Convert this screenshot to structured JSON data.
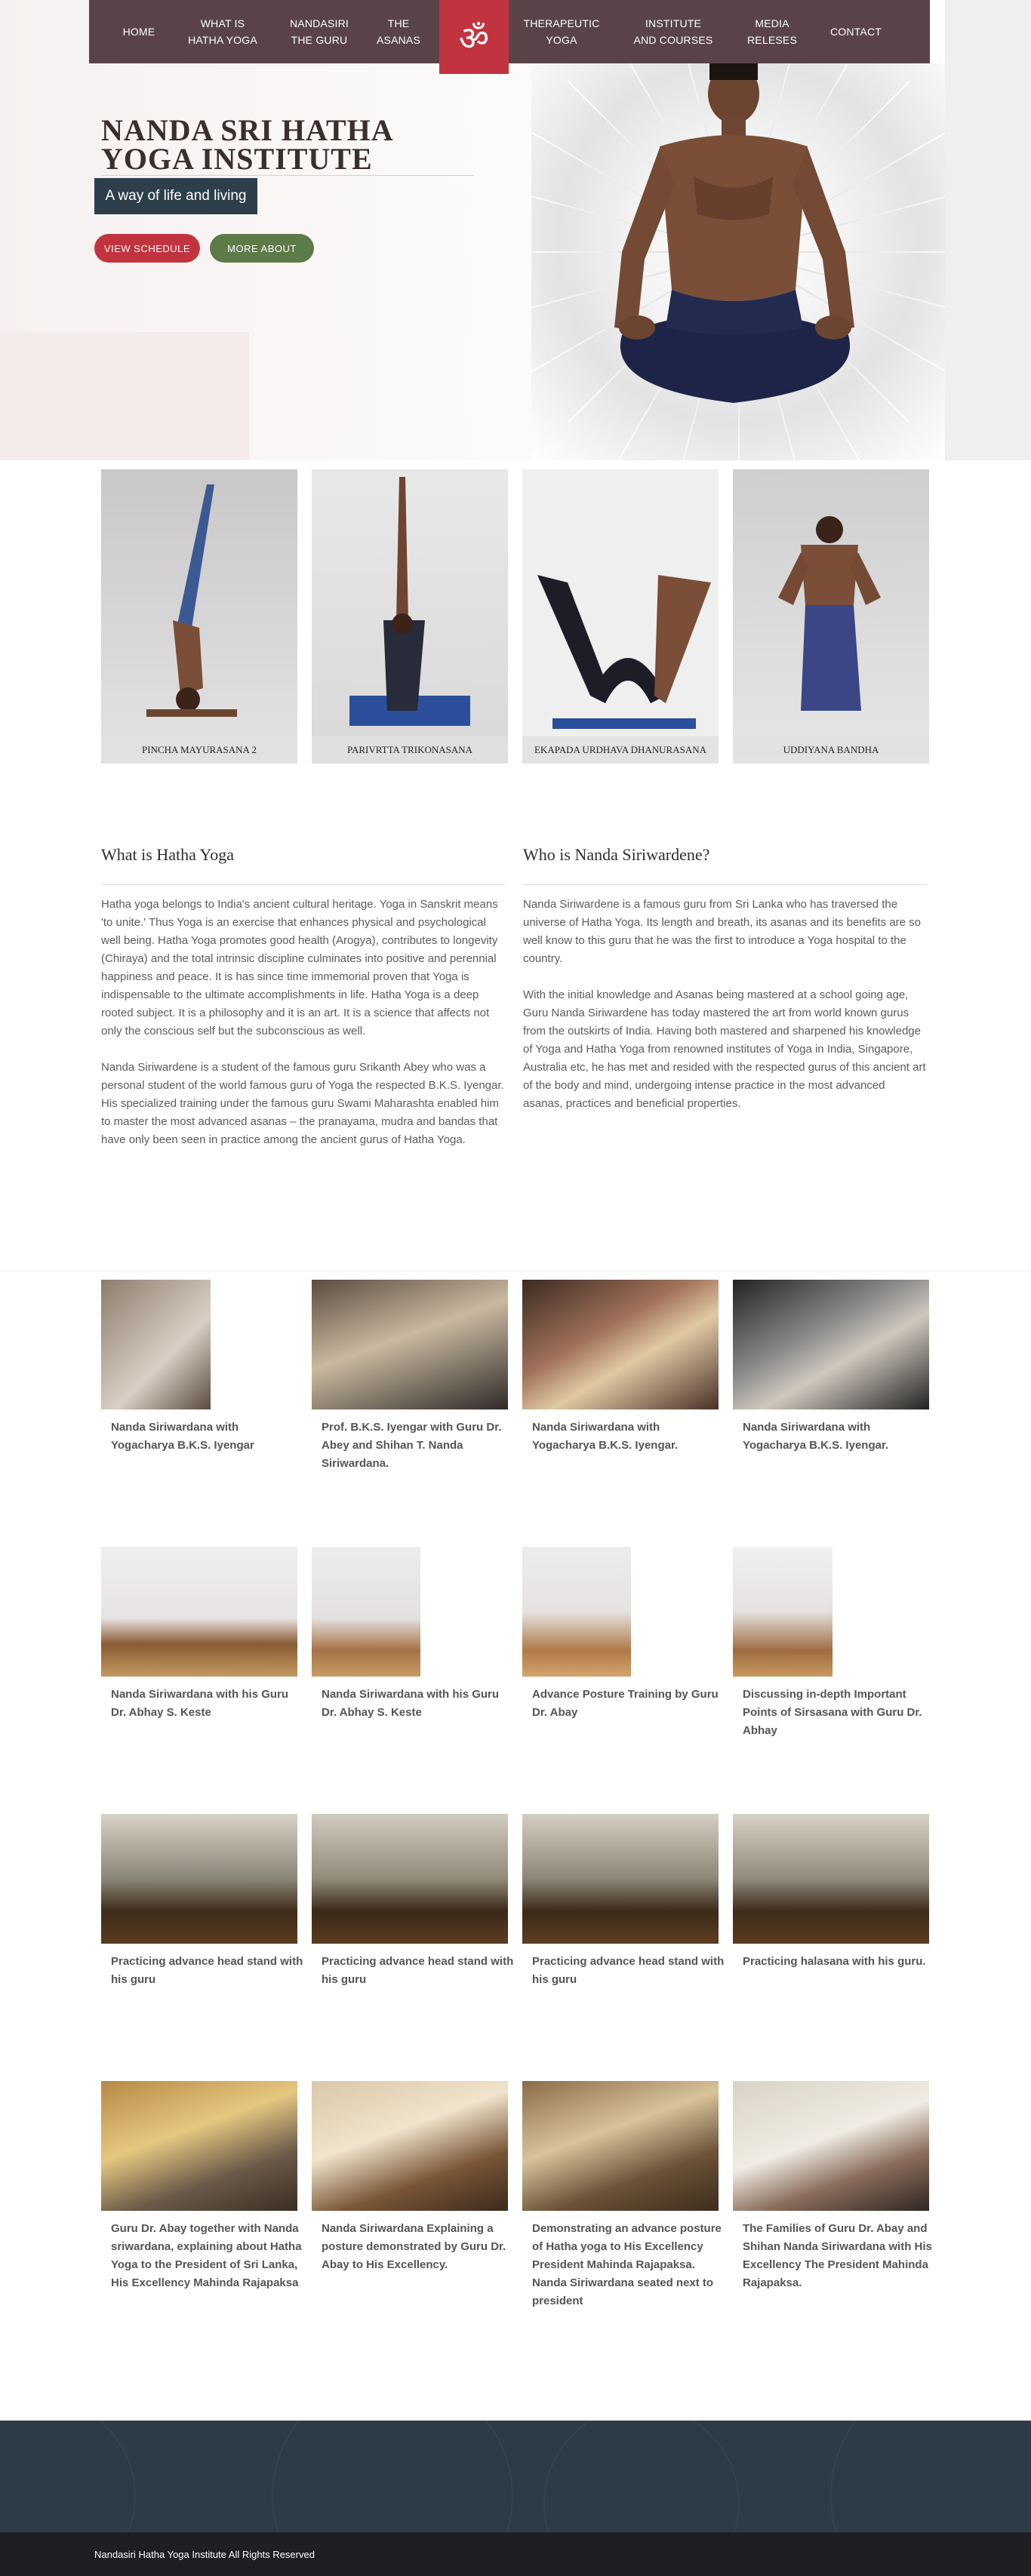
{
  "nav": {
    "items": [
      "HOME",
      "WHAT IS\nHATHA YOGA",
      "NANDASIRI\nTHE GURU",
      "THE\nASANAS",
      "THERAPEUTIC\nYOGA",
      "INSTITUTE\nAND COURSES",
      "MEDIA\nRELESES",
      "CONTACT"
    ],
    "logo": "ॐ"
  },
  "hero": {
    "title": "NANDA SRI HATHA YOGA INSTITUTE",
    "tagline": "A way of life and living",
    "primary_button": "VIEW SCHEDULE",
    "secondary_button": "MORE ABOUT"
  },
  "asanas": [
    "PINCHA MAYURASANA 2",
    "PARIVRTTA TRIKONASANA",
    "EKAPADA URDHAVA DHANURASANA",
    "UDDIYANA BANDHA"
  ],
  "about": {
    "left_title": "What is Hatha Yoga",
    "left_p1": "Hatha yoga belongs to India's ancient cultural heritage. Yoga in Sanskrit means 'to unite.' Thus Yoga is an exercise that enhances physical and psychological well being. Hatha Yoga promotes good health (Arogya), contributes to longevity (Chiraya) and the total intrinsic discipline culminates into positive and perennial happiness and peace. It is has since time immemorial proven that Yoga is indispensable to the ultimate accomplishments in life. Hatha Yoga is a deep rooted subject. It is a philosophy and it is an art. It is a science that affects not only the conscious self but the subconscious as well.",
    "left_p2": "Nanda Siriwardene is a student of the famous guru Srikanth Abey who was a personal student of the world famous guru of Yoga the respected B.K.S. Iyengar. His specialized training under the famous guru Swami Maharashta enabled him to master the most advanced asanas – the pranayama, mudra and bandas that have only been seen in practice among the ancient gurus of Hatha Yoga.",
    "right_title": "Who is Nanda Siriwardene?",
    "right_p1": "Nanda Siriwardene is a famous guru from Sri Lanka who has traversed the universe of Hatha Yoga. Its length and breath, its asanas and its benefits are so well know to this guru that he was the first to introduce a Yoga hospital to the country.",
    "right_p2": "With the initial knowledge and Asanas being mastered at a school going age, Guru Nanda Siriwardene has today mastered the art from world known gurus from the outskirts of India. Having both mastered and sharpened his knowledge of Yoga and Hatha Yoga from renowned institutes of Yoga in India, Singapore, Australia etc, he has met and resided with the respected gurus of this ancient art of the body and mind, undergoing intense practice in the most advanced asanas, practices and beneficial properties."
  },
  "gallery": [
    [
      "Nanda Siriwardana with Yogacharya B.K.S. Iyengar",
      "Prof. B.K.S. Iyengar with Guru Dr. Abey and Shihan T. Nanda Siriwardana.",
      "Nanda Siriwardana with Yogacharya B.K.S. Iyengar.",
      "Nanda Siriwardana with Yogacharya B.K.S. Iyengar."
    ],
    [
      "Nanda Siriwardana with his Guru Dr. Abhay S. Keste",
      "Nanda Siriwardana with his Guru Dr. Abhay S. Keste",
      "Advance Posture Training by Guru Dr. Abay",
      "Discussing in-depth Important Points of Sirsasana with Guru Dr. Abhay"
    ],
    [
      "Practicing advance head stand with his guru",
      "Practicing advance head stand with his guru",
      "Practicing advance head stand with his guru",
      "Practicing halasana with his guru."
    ],
    [
      "Guru Dr. Abay together with Nanda sriwardana, explaining about Hatha Yoga to the President of Sri Lanka, His Excellency Mahinda Rajapaksa",
      "Nanda Siriwardana Explaining a posture demonstrated by Guru Dr. Abay to His Excellency.",
      "Demonstrating an advance posture of Hatha yoga to His Excellency President Mahinda Rajapaksa. Nanda Siriwardana seated next to president",
      "The Families of Guru Dr. Abay and Shihan Nanda Siriwardana with His Excellency The President Mahinda Rajapaksa."
    ]
  ],
  "footer": {
    "copyright": "Nandasiri Hatha Yoga Institute All Rights Reserved"
  }
}
